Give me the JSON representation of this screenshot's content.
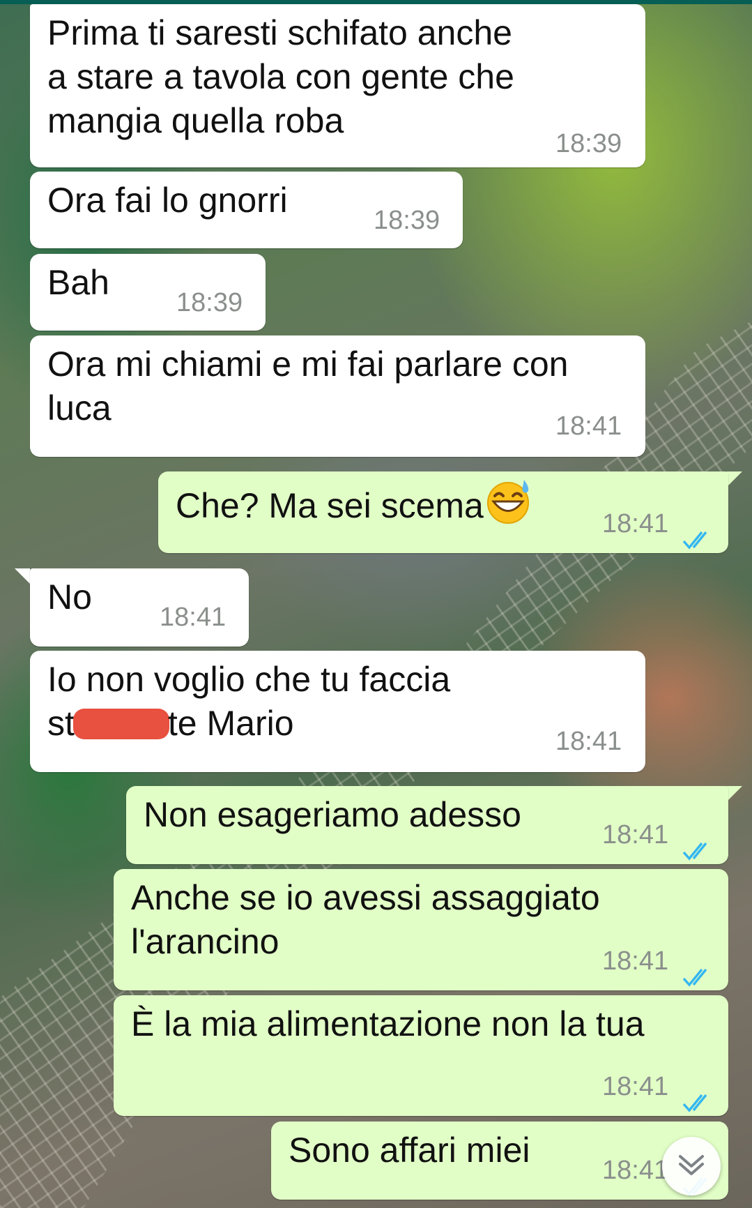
{
  "chat": {
    "messages": [
      {
        "direction": "incoming",
        "lines": [
          "Prima ti saresti schifato anche",
          "a stare a tavola con gente che",
          "mangia quella roba"
        ],
        "time": "18:39"
      },
      {
        "direction": "incoming",
        "text": "Ora fai lo gnorri",
        "time": "18:39"
      },
      {
        "direction": "incoming",
        "text": "Bah",
        "time": "18:39"
      },
      {
        "direction": "incoming",
        "lines": [
          "Ora mi chiami e mi fai parlare con",
          "luca"
        ],
        "time": "18:41"
      },
      {
        "direction": "outgoing",
        "text": "Che? Ma sei scema",
        "emoji": "grinning-face-with-sweat",
        "time": "18:41",
        "status": "read"
      },
      {
        "direction": "incoming",
        "text": "No",
        "time": "18:41"
      },
      {
        "direction": "incoming",
        "line1": "Io non voglio che tu faccia",
        "line2_start": "st",
        "line2_end": "te Mario",
        "redacted": true,
        "time": "18:41"
      },
      {
        "direction": "outgoing",
        "text": "Non esageriamo adesso",
        "time": "18:41",
        "status": "read"
      },
      {
        "direction": "outgoing",
        "lines": [
          "Anche se io avessi assaggiato",
          "l'arancino"
        ],
        "time": "18:41",
        "status": "read"
      },
      {
        "direction": "outgoing",
        "text": "È la mia alimentazione non la tua",
        "time": "18:41",
        "status": "read"
      },
      {
        "direction": "outgoing",
        "text": "Sono affari miei",
        "time": "18:41",
        "status": "read"
      }
    ]
  },
  "scroll_button": {
    "icon": "double-chevron-down-icon"
  },
  "colors": {
    "incoming_bubble": "#ffffff",
    "outgoing_bubble": "#e1fec6",
    "timestamp": "#8a8f8c",
    "read_ticks": "#34b7f1",
    "redaction": "#e8503f",
    "header_line": "#075e54"
  }
}
